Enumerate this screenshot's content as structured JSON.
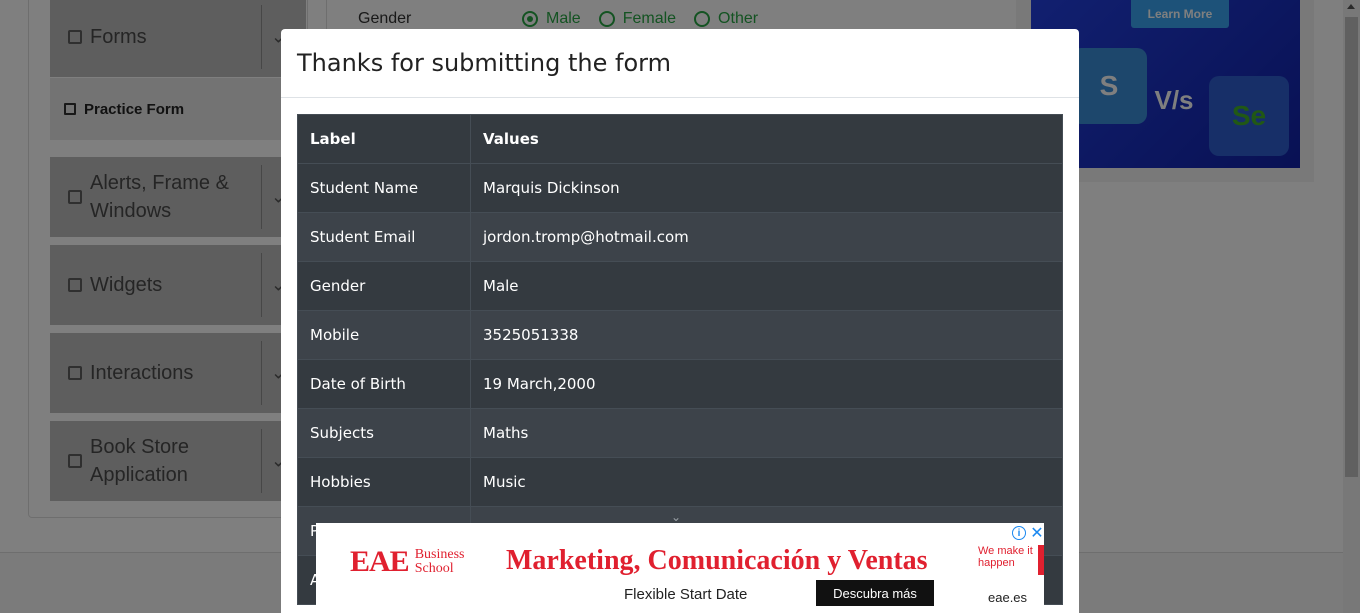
{
  "sidebar": {
    "groups": [
      {
        "label": "Forms"
      },
      {
        "label": "Alerts, Frame & Windows"
      },
      {
        "label": "Widgets"
      },
      {
        "label": "Interactions"
      },
      {
        "label": "Book Store Application"
      }
    ],
    "active_item": "Practice Form"
  },
  "form": {
    "gender_label": "Gender",
    "gender_options": [
      "Male",
      "Female",
      "Other"
    ],
    "gender_selected": "Male"
  },
  "side_ad": {
    "button": "Learn More",
    "tile_left": "S",
    "versus": "V/s",
    "tile_right": "Se"
  },
  "modal": {
    "title": "Thanks for submitting the form",
    "columns": [
      "Label",
      "Values"
    ],
    "rows": [
      {
        "label": "Student Name",
        "value": "Marquis Dickinson"
      },
      {
        "label": "Student Email",
        "value": "jordon.tromp@hotmail.com"
      },
      {
        "label": "Gender",
        "value": "Male"
      },
      {
        "label": "Mobile",
        "value": "3525051338"
      },
      {
        "label": "Date of Birth",
        "value": "19 March,2000"
      },
      {
        "label": "Subjects",
        "value": "Maths"
      },
      {
        "label": "Hobbies",
        "value": "Music"
      },
      {
        "label": "P",
        "value": ""
      },
      {
        "label": "A",
        "value": ""
      }
    ]
  },
  "bottom_ad": {
    "logo_big": "EAE",
    "logo_line1": "Business",
    "logo_line2": "School",
    "headline": "Marketing, Comunicación y Ventas",
    "tag": "We make it happen",
    "subtext": "Flexible Start Date",
    "cta": "Descubra más",
    "domain": "eae.es"
  },
  "colors": {
    "overlay": "#000000",
    "table_dark": "#343a40",
    "radio_green": "#28a745",
    "ad_red": "#e0202f",
    "ad_blue": "#2340e0"
  }
}
